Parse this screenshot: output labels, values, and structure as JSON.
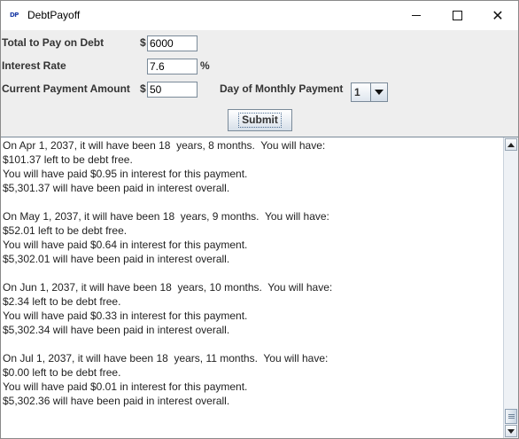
{
  "window": {
    "title": "DebtPayoff",
    "icon_text": "DP",
    "controls": [
      "minimize-icon",
      "maximize-icon",
      "close-icon"
    ]
  },
  "form": {
    "total_label": "Total to Pay on Debt",
    "total_currency": "$",
    "total_value": "6000",
    "rate_label": "Interest Rate",
    "rate_value": "7.6",
    "rate_unit": "%",
    "payment_label": "Current Payment Amount",
    "payment_currency": "$",
    "payment_value": "50",
    "day_label": "Day of Monthly Payment",
    "day_value": "1",
    "submit_label": "Submit"
  },
  "output": {
    "lines": [
      "On Apr 1, 2037, it will have been 18  years, 8 months.  You will have:",
      "$101.37 left to be debt free.",
      "You will have paid $0.95 in interest for this payment.",
      "$5,301.37 will have been paid in interest overall.",
      "",
      "On May 1, 2037, it will have been 18  years, 9 months.  You will have:",
      "$52.01 left to be debt free.",
      "You will have paid $0.64 in interest for this payment.",
      "$5,302.01 will have been paid in interest overall.",
      "",
      "On Jun 1, 2037, it will have been 18  years, 10 months.  You will have:",
      "$2.34 left to be debt free.",
      "You will have paid $0.33 in interest for this payment.",
      "$5,302.34 will have been paid in interest overall.",
      "",
      "On Jul 1, 2037, it will have been 18  years, 11 months.  You will have:",
      "$0.00 left to be debt free.",
      "You will have paid $0.01 in interest for this payment.",
      "$5,302.36 will have been paid in interest overall."
    ]
  }
}
